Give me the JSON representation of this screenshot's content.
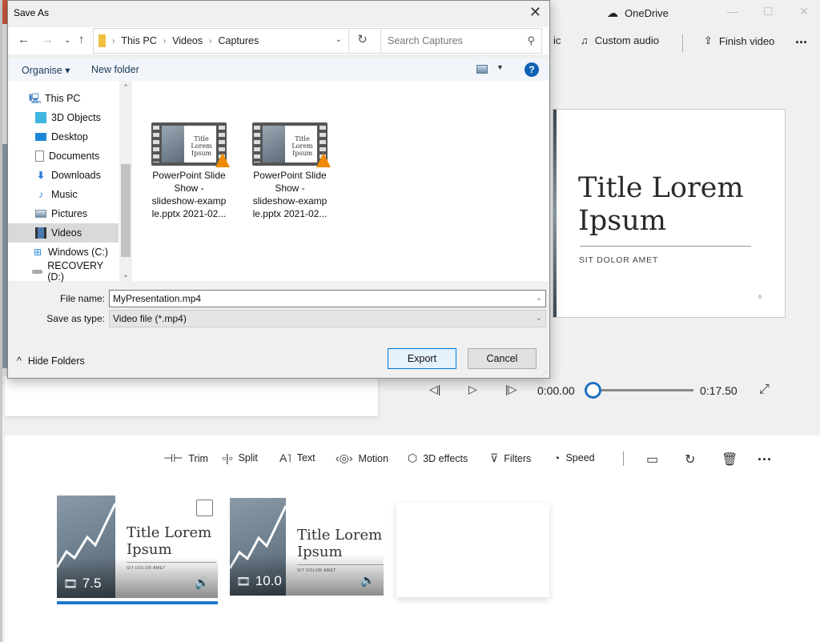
{
  "app": {
    "title": "OneDrive",
    "cloud_icon": "cloud-offline-icon",
    "window_controls": [
      "minimize",
      "maximize",
      "close"
    ],
    "toolbar": {
      "music_partial": "ic",
      "custom_audio": "Custom audio",
      "finish_video": "Finish video",
      "more": "..."
    },
    "preview": {
      "title_line1": "Title Lorem",
      "title_line2": "Ipsum",
      "subtitle": "SIT DOLOR AMET",
      "mark": "ö"
    },
    "playback": {
      "current_time": "0:00.00",
      "total_time": "0:17.50",
      "progress_fraction": 0.0
    },
    "edit_tools": [
      {
        "label": "Trim",
        "icon": "trim-icon"
      },
      {
        "label": "Split",
        "icon": "split-icon"
      },
      {
        "label": "Text",
        "icon": "text-icon"
      },
      {
        "label": "Motion",
        "icon": "motion-icon"
      },
      {
        "label": "3D effects",
        "icon": "3d-effects-icon"
      },
      {
        "label": "Filters",
        "icon": "filters-icon"
      },
      {
        "label": "Speed",
        "icon": "speed-icon"
      }
    ],
    "clips": [
      {
        "title_line1": "Title Lorem",
        "title_line2": "Ipsum",
        "subtitle": "SIT DOLOR AMET",
        "duration": "7.5",
        "selected": true
      },
      {
        "title_line1": "Title Lorem",
        "title_line2": "Ipsum",
        "subtitle": "SIT DOLOR AMET",
        "duration": "10.0",
        "selected": false
      }
    ]
  },
  "dialog": {
    "title": "Save As",
    "breadcrumb": [
      "This PC",
      "Videos",
      "Captures"
    ],
    "search_placeholder": "Search Captures",
    "organise": "Organise ▾",
    "new_folder": "New folder",
    "help": "?",
    "tree": [
      {
        "label": "This PC",
        "icon": "pc-icon"
      },
      {
        "label": "3D Objects",
        "icon": "3d-objects-icon"
      },
      {
        "label": "Desktop",
        "icon": "desktop-icon"
      },
      {
        "label": "Documents",
        "icon": "documents-icon"
      },
      {
        "label": "Downloads",
        "icon": "downloads-icon"
      },
      {
        "label": "Music",
        "icon": "music-icon"
      },
      {
        "label": "Pictures",
        "icon": "pictures-icon"
      },
      {
        "label": "Videos",
        "icon": "videos-icon",
        "selected": true
      },
      {
        "label": "Windows (C:)",
        "icon": "drive-c-icon"
      },
      {
        "label": "RECOVERY (D:)",
        "icon": "drive-d-icon"
      }
    ],
    "files": [
      {
        "name": "PowerPoint Slide Show - slideshow-example.pptx 2021-02...",
        "line1": "PowerPoint Slide",
        "line2": "Show  -",
        "line3": "slideshow-examp",
        "line4": "le.pptx 2021-02...",
        "thumb_title": "Title Lorem Ipsum"
      },
      {
        "name": "PowerPoint Slide Show - slideshow-example.pptx 2021-02...",
        "line1": "PowerPoint Slide",
        "line2": "Show  -",
        "line3": "slideshow-examp",
        "line4": "le.pptx 2021-02...",
        "thumb_title": "Title Lorem Ipsum"
      }
    ],
    "file_name_label": "File name:",
    "file_name_value": "MyPresentation.mp4",
    "save_type_label": "Save as type:",
    "save_type_value": "Video file (*.mp4)",
    "hide_folders": "Hide Folders",
    "export": "Export",
    "cancel": "Cancel"
  }
}
